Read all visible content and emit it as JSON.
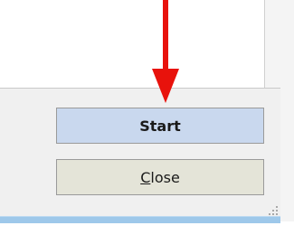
{
  "dialog": {
    "start_label": "Start",
    "close_label_mnemonic": "C",
    "close_label_rest": "lose"
  },
  "annotation": {
    "arrow_color": "#e8120c",
    "arrow_icon": "down-arrow-icon"
  },
  "colors": {
    "start_button_bg": "#c9d8ee",
    "close_button_bg": "#e4e4d8",
    "bottom_bar": "#9ec8ea"
  }
}
